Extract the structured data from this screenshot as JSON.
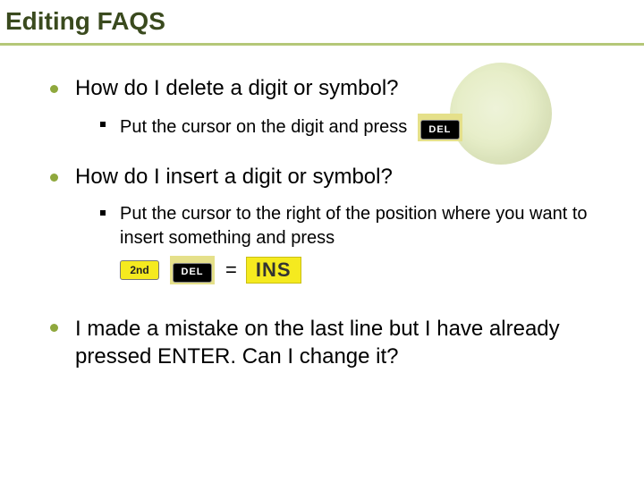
{
  "title": "Editing FAQS",
  "faqs": [
    {
      "question": "How do I delete a digit or symbol?",
      "answer": "Put the cursor on the digit and press"
    },
    {
      "question": "How do I insert a digit or symbol?",
      "answer": "Put the cursor to the right of the position where you want to insert something and press"
    },
    {
      "question": "I made a mistake on the last line but I have already pressed ENTER.  Can I change it?"
    }
  ],
  "keys": {
    "del": "DEL",
    "second": "2nd",
    "equals": "=",
    "ins": "INS"
  }
}
